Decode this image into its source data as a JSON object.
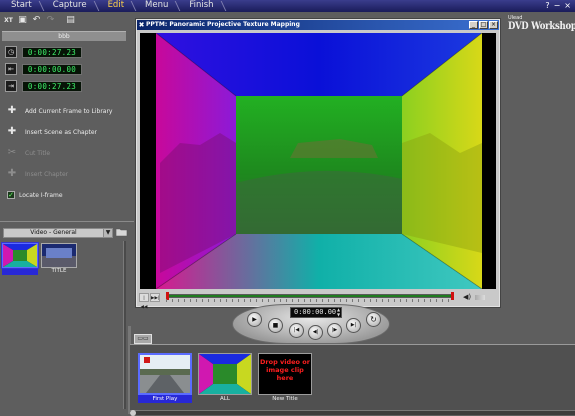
{
  "nav": {
    "steps": [
      "Start",
      "Capture",
      "Edit",
      "Menu",
      "Finish"
    ],
    "active": "Edit"
  },
  "window_controls": {
    "help": "?",
    "minimize": "−",
    "close": "×"
  },
  "toolbar": {
    "icons": [
      "xt-icon",
      "save-icon",
      "undo-icon",
      "redo-icon",
      "save-as-icon"
    ],
    "glyphs": [
      "XT",
      "▣",
      "↶",
      "↷",
      "▤"
    ]
  },
  "left_panel": {
    "title": "bbb",
    "timecodes": [
      {
        "icon": "◷",
        "value": "0:00:27.23"
      },
      {
        "icon": "⇤",
        "value": "0:00:00.00"
      },
      {
        "icon": "⇥",
        "value": "0:00:27.23"
      }
    ],
    "actions": [
      {
        "label": "Add Current Frame to Library",
        "enabled": true,
        "glyph": "✚"
      },
      {
        "label": "Insert Scene as Chapter",
        "enabled": true,
        "glyph": "✚"
      },
      {
        "label": "Cut Title",
        "enabled": false,
        "glyph": "✂"
      },
      {
        "label": "Insert Chapter",
        "enabled": false,
        "glyph": "✚"
      }
    ],
    "locate_iframe": {
      "label": "Locate I-frame",
      "checked": true,
      "check_glyph": "✓"
    }
  },
  "library": {
    "category": "Video - General",
    "dropdown_arrow": "▼",
    "folder_glyph": "📂",
    "items": [
      {
        "label": "",
        "selected": true
      },
      {
        "label": "TITLE",
        "selected": false
      }
    ]
  },
  "brand": {
    "prefix": "Ulead",
    "name": "DVD Workshop"
  },
  "player": {
    "title": "PPTM: Panoramic Projective Texture Mapping",
    "title_icon": "✖",
    "buttons": [
      "_",
      "□",
      "×"
    ],
    "bar_buttons": [
      "|◀◀",
      "▶▶|"
    ],
    "volume_glyph": "◀)",
    "timecode": "0:00:00.00",
    "spin": [
      "▲",
      "▼"
    ],
    "transport": {
      "play": "▶",
      "stop": "■",
      "prev": "|◀",
      "step_back": "◀|",
      "step_fwd": "|▶",
      "next": "▶|",
      "repeat": "↻"
    }
  },
  "storyboard": {
    "strip_button": "▭▭",
    "items": [
      {
        "label": "First Play",
        "selected": true,
        "badge": "1"
      },
      {
        "label": "ALL",
        "selected": false,
        "badge": ""
      },
      {
        "label": "New Title",
        "selected": false,
        "placeholder": "Drop video or image clip here"
      }
    ]
  },
  "colors": {
    "nav_active": "#ffd34a",
    "timecode_green": "#3ef06a",
    "selection_blue": "#2828d6",
    "drop_text_red": "#ff1f1f",
    "title_bar_blue": "#0a246a"
  }
}
